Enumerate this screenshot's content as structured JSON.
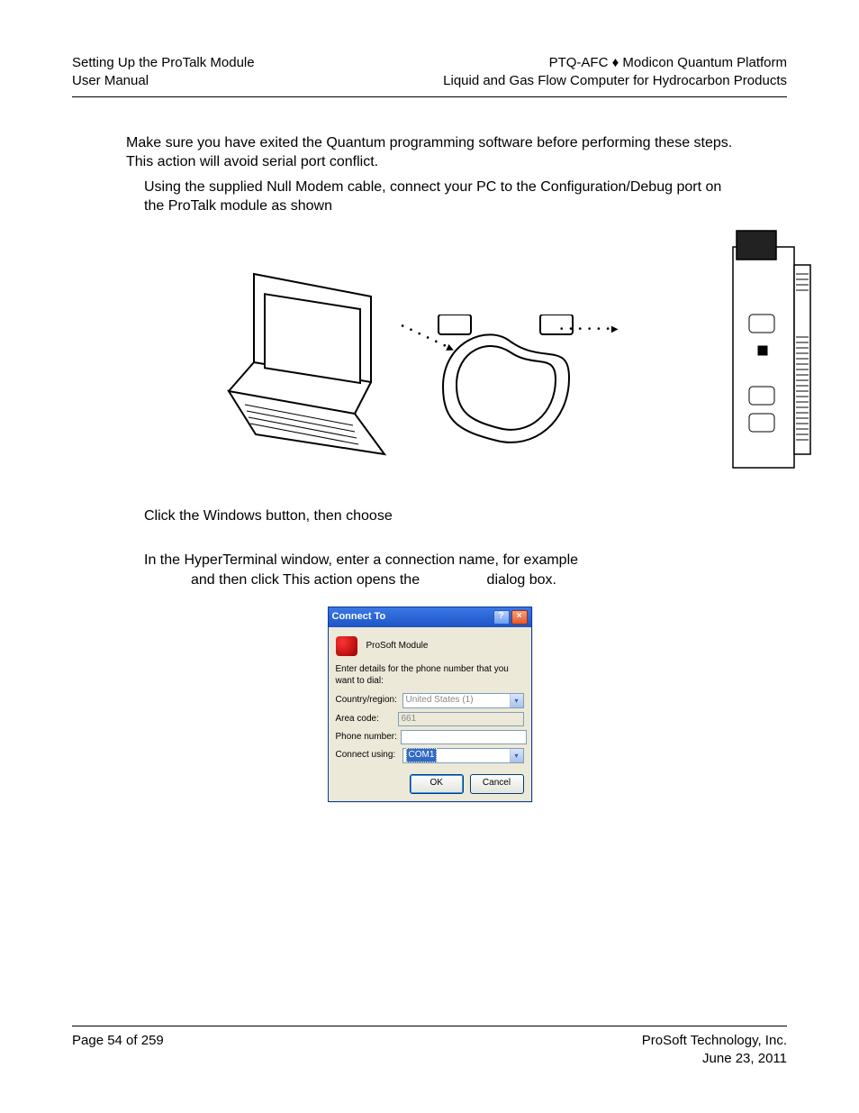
{
  "header": {
    "left_line1": "Setting Up the ProTalk Module",
    "left_line2": "User Manual",
    "right_line1": "PTQ-AFC ♦ Modicon Quantum Platform",
    "right_line2": "Liquid and Gas Flow Computer for Hydrocarbon Products"
  },
  "body": {
    "para1": "Make sure you have exited the Quantum programming software before performing these steps. This action will avoid serial port conflict.",
    "step1": "Using the supplied Null Modem cable, connect your PC to the Configuration/Debug port on the ProTalk module as shown",
    "step2a": "Click the Windows ",
    "step2b": " button, then choose ",
    "step3a": "In the HyperTerminal window, enter a connection name, for example ",
    "step3b": " and then click ",
    "step3c": " This action opens the ",
    "step3d": " dialog box."
  },
  "dialog": {
    "title": "Connect To",
    "module_name": "ProSoft Module",
    "instruction": "Enter details for the phone number that you want to dial:",
    "labels": {
      "country": "Country/region:",
      "area": "Area code:",
      "phone": "Phone number:",
      "connect": "Connect using:"
    },
    "values": {
      "country": "United States (1)",
      "area": "661",
      "phone": "",
      "connect": "COM1"
    },
    "buttons": {
      "ok": "OK",
      "cancel": "Cancel"
    }
  },
  "footer": {
    "left": "Page 54 of 259",
    "right_line1": "ProSoft Technology, Inc.",
    "right_line2": "June 23, 2011"
  }
}
